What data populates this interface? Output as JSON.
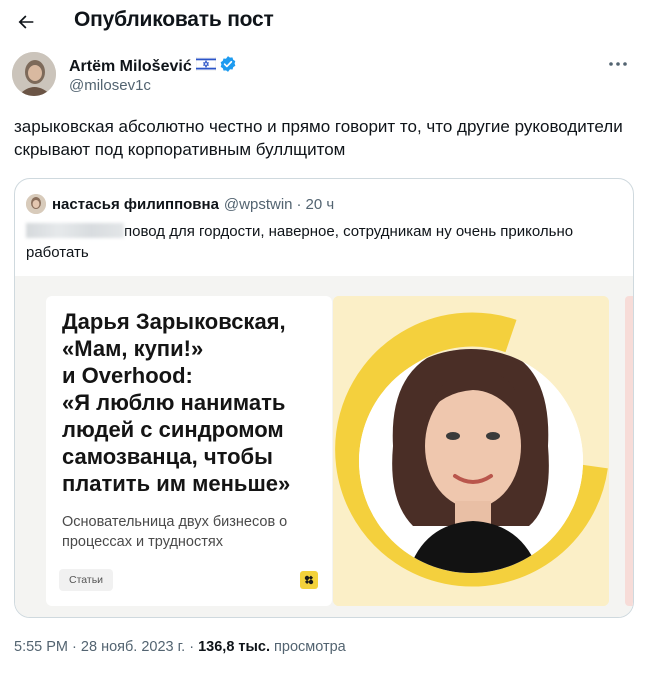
{
  "header": {
    "title": "Опубликовать пост"
  },
  "post": {
    "author_name": "Artëm Milošević",
    "author_handle": "@milosev1c",
    "text": "зарыковская абсолютно честно и прямо говорит то, что другие руководители скрывают под корпоративным буллщитом",
    "time": "5:55 PM",
    "date": "28 нояб. 2023 г.",
    "views_count": "136,8 тыс.",
    "views_label": "просмотра",
    "separator": "·"
  },
  "quote": {
    "author_name": "настасья филипповна",
    "handle": "@wpstwin",
    "separator": "·",
    "time_ago": "20 ч",
    "text": "повод для гордости, наверное, сотрудникам ну очень прикольно работать"
  },
  "article": {
    "headline_lines": [
      "Дарья Зарыковская,",
      "«Мам, купи!»",
      "и Overhood:",
      "«Я люблю нанимать",
      "людей с синдромом",
      "самозванца, чтобы",
      "платить им меньше»"
    ],
    "subtitle": "Основательница двух бизнесов о процессах и трудностях",
    "tag": "Статьи"
  },
  "colors": {
    "accent_blue": "#1d9bf0",
    "brand_yellow": "#f3d23b",
    "muted_text": "#536471",
    "border": "#cfd9de"
  },
  "icons": {
    "back": "arrow-left-icon",
    "verified": "verified-badge-icon",
    "flag": "israel-flag-icon",
    "more": "more-dots-icon",
    "brand": "brand-logo-icon"
  }
}
